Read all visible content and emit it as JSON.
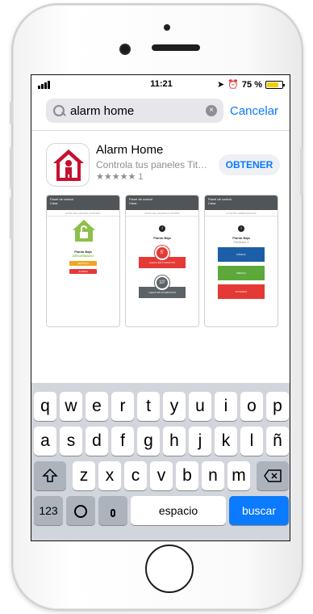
{
  "status_bar": {
    "time": "11:21",
    "battery": "75 %",
    "battery_level": 0.75,
    "icons": [
      "signal-icon",
      "location-icon",
      "alarm-icon",
      "battery-icon"
    ]
  },
  "search": {
    "query": "alarm home",
    "cancel_label": "Cancelar"
  },
  "app": {
    "name": "Alarm Home",
    "subtitle": "Controla tus paneles Tita...",
    "stars": "★★★★★",
    "rating_count": "1",
    "get_label": "OBTENER",
    "icon_colors": {
      "red": "#c8102e",
      "white": "#ffffff"
    }
  },
  "screenshots": [
    {
      "header": "Panel de control",
      "nav": "Casa",
      "tabs": "AVISO DE LLEGADA     CONTROL",
      "title": "Planta Baja",
      "state": "DESARMADO",
      "buttons": [
        "ARMADO",
        "ALERTA"
      ]
    },
    {
      "header": "Panel de control",
      "nav": "Casa",
      "tabs": "AVISO DE LLEGADA     CONTROL",
      "title": "Planta Baja",
      "buttons": [
        "LLEGO EN 5 MINUTOS",
        "LLEGO EN 10 MINUTOS"
      ]
    },
    {
      "header": "Panel de control",
      "nav": "Casa",
      "tabs": "CONTROL     EMERGENCIAS",
      "title": "Planta Baja",
      "subtitle": "Partición 1",
      "buttons": [
        "PÁNICO",
        "MÉDICA",
        "INCENDIO"
      ]
    }
  ],
  "keyboard": {
    "row1": [
      "q",
      "w",
      "e",
      "r",
      "t",
      "y",
      "u",
      "i",
      "o",
      "p"
    ],
    "row2": [
      "a",
      "s",
      "d",
      "f",
      "g",
      "h",
      "j",
      "k",
      "l",
      "ñ"
    ],
    "row3": [
      "z",
      "x",
      "c",
      "v",
      "b",
      "n",
      "m"
    ],
    "numbers_label": "123",
    "space_label": "espacio",
    "search_label": "buscar"
  }
}
